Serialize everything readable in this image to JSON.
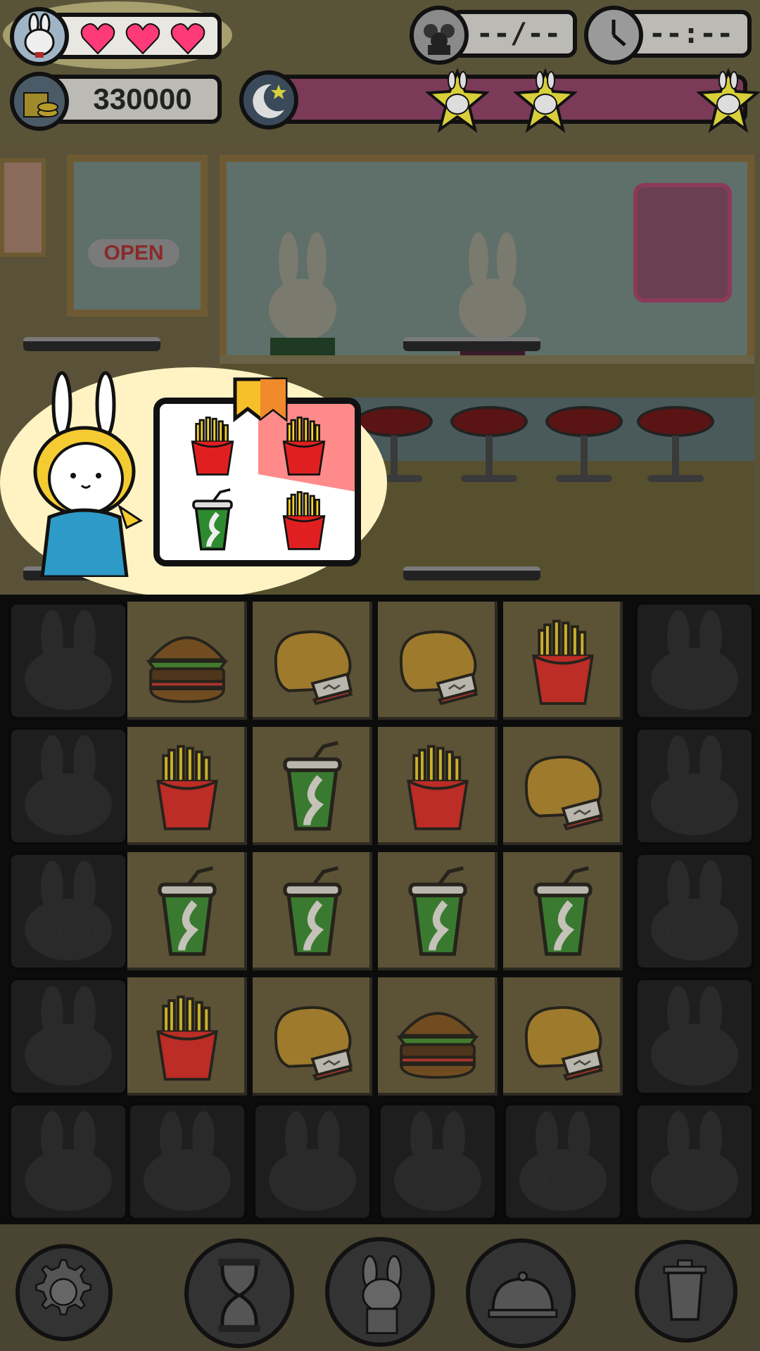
{
  "hud": {
    "lives": 3,
    "customers_counter": "--/--",
    "timer": "--:--",
    "coins": "330000"
  },
  "board": {
    "closed_label": "CLOSED",
    "rows": [
      [
        "closed",
        "burger",
        "nugget",
        "nugget",
        "fries",
        "closed"
      ],
      [
        "closed",
        "fries",
        "drink",
        "fries",
        "nugget",
        "closed"
      ],
      [
        "closed",
        "drink",
        "drink",
        "drink",
        "drink",
        "closed"
      ],
      [
        "closed",
        "fries",
        "nugget",
        "burger",
        "nugget",
        "closed"
      ],
      [
        "closed",
        "closed",
        "closed",
        "closed",
        "closed",
        "closed"
      ]
    ]
  },
  "scene": {
    "open_sign": "OPEN",
    "order": [
      "fries",
      "fries",
      "drink",
      "fries"
    ]
  },
  "toolbar": {
    "buttons": [
      "settings-icon",
      "hourglass-icon",
      "bunny-helper-icon",
      "cloche-icon",
      "trash-icon"
    ]
  },
  "colors": {
    "heart": "#ff3a7a",
    "fries_box": "#e02020",
    "fries": "#f6d327",
    "drink_cup": "#2e8a2e",
    "order_bubble": "#fff3c4",
    "progress_bar": "#7a3a58",
    "star": "#d8cf3a"
  }
}
